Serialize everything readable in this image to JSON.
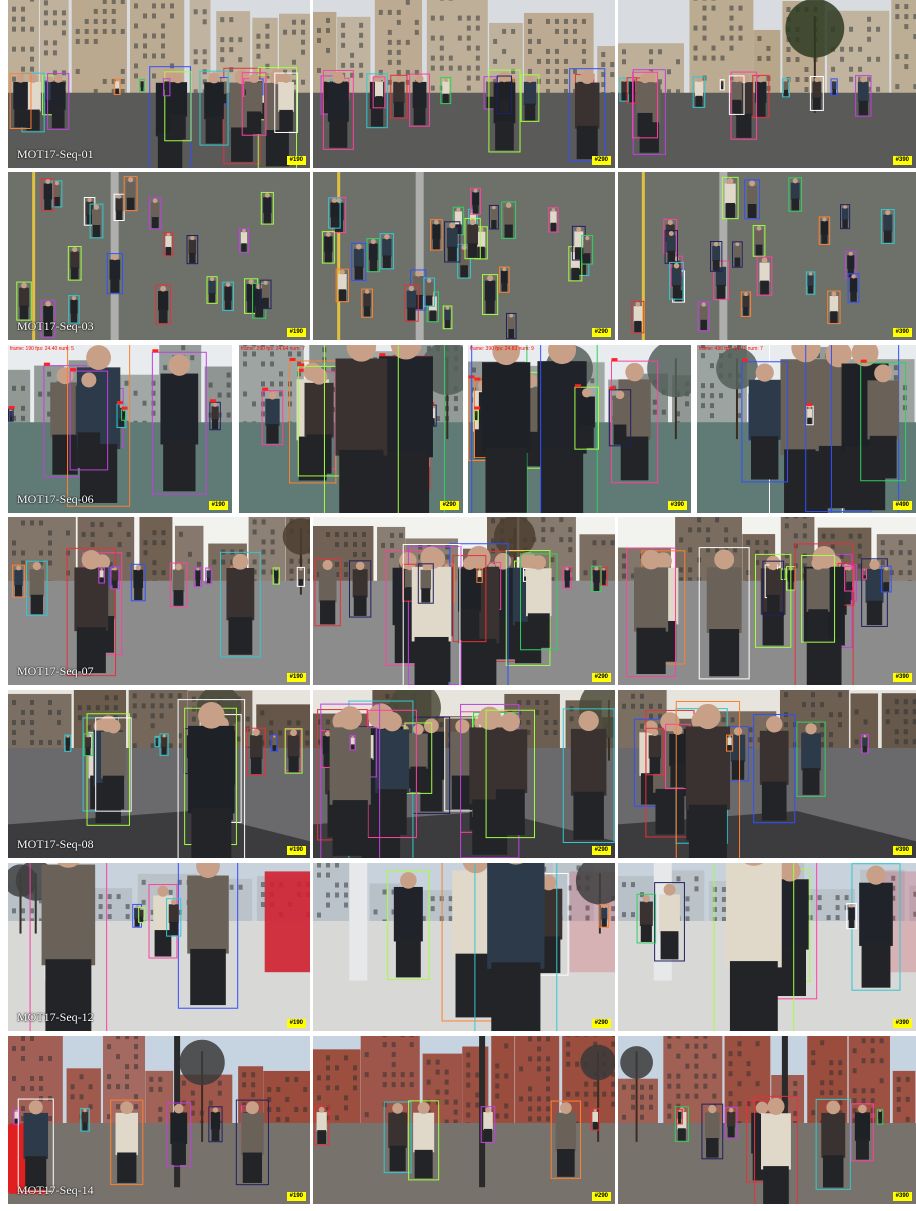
{
  "rows": [
    {
      "label": "MOT17-Seq-01",
      "scene": "plaza",
      "panels": [
        {
          "frame": "#190"
        },
        {
          "frame": "#290"
        },
        {
          "frame": "#390"
        }
      ]
    },
    {
      "label": "MOT17-Seq-03",
      "scene": "crowd-top",
      "panels": [
        {
          "frame": "#190"
        },
        {
          "frame": "#290"
        },
        {
          "frame": "#390"
        }
      ]
    },
    {
      "label": "MOT17-Seq-06",
      "scene": "street-low",
      "panels": [
        {
          "frame": "#190",
          "overlay": "frame: 190 fps: 24.40 num: 5"
        },
        {
          "frame": "#290",
          "overlay": "frame: 290 fps: 24.64 num: 7"
        },
        {
          "frame": "#390",
          "overlay": "frame: 390 fps: 24.83 num: 9"
        },
        {
          "frame": "#490",
          "overlay": "frame: 490 fps: 24.71 num: 7"
        }
      ]
    },
    {
      "label": "MOT17-Seq-07",
      "scene": "shopping-street",
      "panels": [
        {
          "frame": "#190"
        },
        {
          "frame": "#290"
        },
        {
          "frame": "#390"
        }
      ]
    },
    {
      "label": "MOT17-Seq-08",
      "scene": "sunny-plaza",
      "panels": [
        {
          "frame": "#190"
        },
        {
          "frame": "#290"
        },
        {
          "frame": "#390"
        }
      ]
    },
    {
      "label": "MOT17-Seq-12",
      "scene": "mall",
      "panels": [
        {
          "frame": "#190"
        },
        {
          "frame": "#290"
        },
        {
          "frame": "#390"
        }
      ]
    },
    {
      "label": "MOT17-Seq-14",
      "scene": "city-tram",
      "panels": [
        {
          "frame": "#190"
        },
        {
          "frame": "#290"
        },
        {
          "frame": "#390"
        }
      ]
    }
  ],
  "box_colors": [
    "#e8303a",
    "#3050ff",
    "#30d060",
    "#c040e0",
    "#30c8d0",
    "#ff8030",
    "#202060",
    "#ff40a0",
    "#a0ff40",
    "#ffffff"
  ]
}
